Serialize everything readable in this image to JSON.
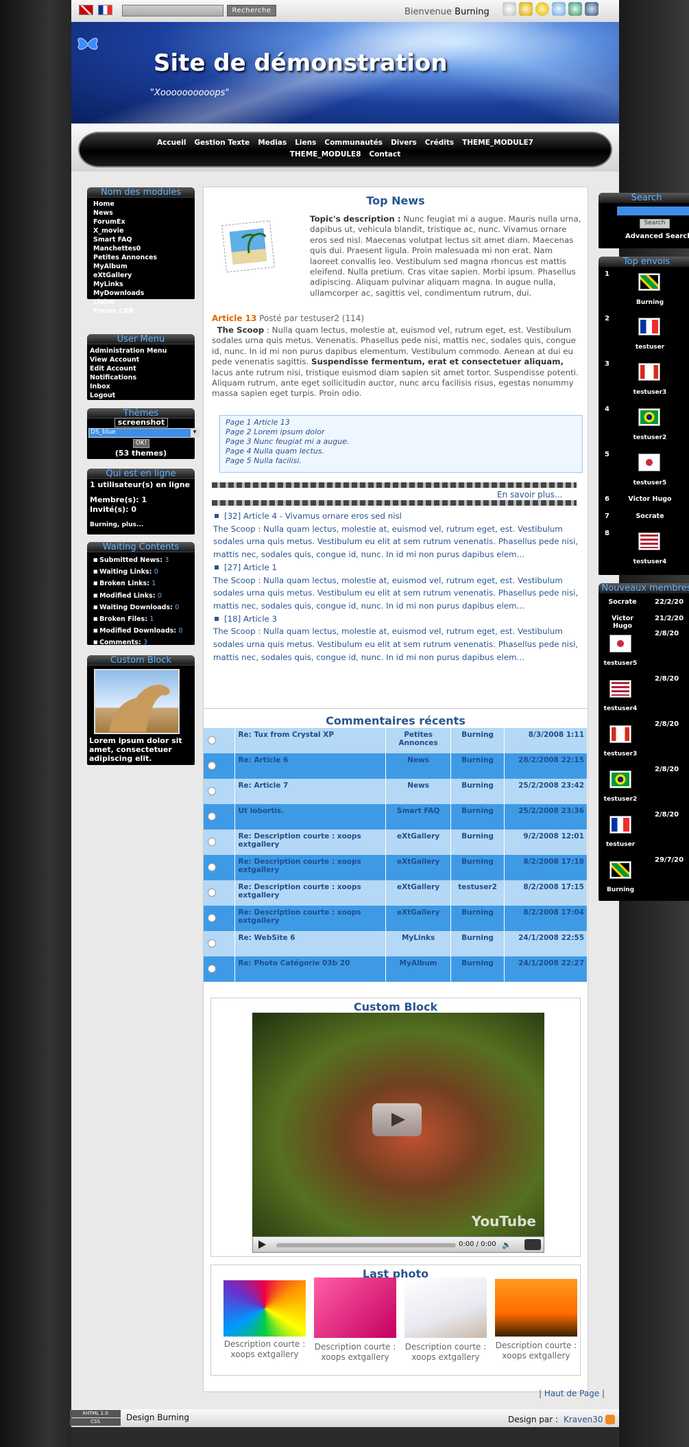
{
  "topbar": {
    "search_button": "Recherche",
    "welcome_prefix": "Bienvenue",
    "welcome_user": "Burning"
  },
  "header": {
    "title": "Site de démonstration",
    "slogan": "\"Xoooooooooops\""
  },
  "nav": {
    "row1": [
      "Accueil",
      "Gestion Texte",
      "Medias",
      "Liens",
      "Communautés",
      "Divers",
      "Crédits",
      "THEME_MODULE7"
    ],
    "row2": [
      "THEME_MODULE8",
      "Contact"
    ]
  },
  "modules": {
    "title": "Nom des modules",
    "items": [
      "Home",
      "News",
      "ForumEx",
      "X_movie",
      "Smart FAQ",
      "Manchettes0",
      "Petites Annonces",
      "MyAlbum",
      "eXtGallery",
      "MyLinks",
      "MyDownloads",
      "Liaise",
      "Forum CBB"
    ]
  },
  "usermenu": {
    "title": "User Menu",
    "items": [
      "Administration Menu",
      "View Account",
      "Edit Account",
      "Notifications",
      "Inbox",
      "Logout"
    ]
  },
  "themes": {
    "title": "Thèmes",
    "screenshot": "screenshot",
    "selected": "DS_blue",
    "ok": "OK!",
    "count": "(53 themes)"
  },
  "online": {
    "title": "Qui est en ligne",
    "line1": "1 utilisateur(s) en ligne",
    "line2": "Membre(s): 1",
    "line3": "Invité(s): 0",
    "line4": "Burning, plus..."
  },
  "waiting": {
    "title": "Waiting Contents",
    "items": [
      {
        "label": "Submitted News:",
        "value": "3"
      },
      {
        "label": "Waiting Links:",
        "value": "0"
      },
      {
        "label": "Broken Links:",
        "value": "1"
      },
      {
        "label": "Modified Links:",
        "value": "0"
      },
      {
        "label": "Waiting Downloads:",
        "value": "0"
      },
      {
        "label": "Broken Files:",
        "value": "1"
      },
      {
        "label": "Modified Downloads:",
        "value": "0"
      },
      {
        "label": "Comments:",
        "value": "3"
      }
    ]
  },
  "custom_left": {
    "title": "Custom Block",
    "text": "Lorem ipsum dolor sit amet, consectetuer adipiscing elit."
  },
  "topnews": {
    "title": "Top News",
    "topic_label": "Topic's description :",
    "topic_text": "Nunc feugiat mi a augue. Mauris nulla urna, dapibus ut, vehicula blandit, tristique ac, nunc. Vivamus ornare eros sed nisl. Maecenas volutpat lectus sit amet diam. Maecenas quis dui. Praesent ligula. Proin malesuada mi non erat. Nam laoreet convallis leo. Vestibulum sed magna rhoncus est mattis eleifend. Nulla pretium. Cras vitae sapien. Morbi ipsum. Phasellus adipiscing. Aliquam pulvinar aliquam magna. In augue nulla, ullamcorper ac, sagittis vel, condimentum rutrum, dui.",
    "article_label": "Article 13",
    "posted": "Posté par testuser2 (114)",
    "scoop_label": "The Scoop",
    "scoop_text": ": Nulla quam lectus, molestie at, euismod vel, rutrum eget, est. Vestibulum sodales urna quis metus. Venenatis. Phasellus pede nisi, mattis nec, sodales quis, congue id, nunc. In id mi non purus dapibus elementum. Vestibulum commodo. Aenean at dui eu pede venenatis sagittis.",
    "bold_text": "Suspendisse fermentum, erat et consectetuer aliquam,",
    "scoop_text2": "lacus ante rutrum nisi, tristique euismod diam sapien sit amet tortor. Suspendisse potenti. Aliquam rutrum, ante eget sollicitudin auctor, nunc arcu facilisis risus, egestas nonummy massa sapien eget turpis. Proin odio.",
    "pages": [
      "Page 1 Article 13",
      "Page 2 Lorem ipsum dolor",
      "Page 3 Nunc feugiat mi a augue.",
      "Page 4 Nulla quam lectus.",
      "Page 5 Nulla facilisi."
    ],
    "more": "En savoir plus...",
    "list": [
      {
        "title": "[32] Article 4 - Vivamus ornare eros sed nisl",
        "text": "The Scoop : Nulla quam lectus, molestie at, euismod vel, rutrum eget, est. Vestibulum sodales urna quis metus. Vestibulum eu elit at sem rutrum venenatis. Phasellus pede nisi, mattis nec, sodales quis, congue id, nunc. In id mi non purus dapibus elem..."
      },
      {
        "title": "[27] Article 1",
        "text": "The Scoop : Nulla quam lectus, molestie at, euismod vel, rutrum eget, est. Vestibulum sodales urna quis metus. Vestibulum eu elit at sem rutrum venenatis. Phasellus pede nisi, mattis nec, sodales quis, congue id, nunc. In id mi non purus dapibus elem..."
      },
      {
        "title": "[18] Article 3",
        "text": "The Scoop : Nulla quam lectus, molestie at, euismod vel, rutrum eget, est. Vestibulum sodales urna quis metus. Vestibulum eu elit at sem rutrum venenatis. Phasellus pede nisi, mattis nec, sodales quis, congue id, nunc. In id mi non purus dapibus elem..."
      }
    ]
  },
  "comments": {
    "title": "Commentaires récents",
    "rows": [
      {
        "t": "Re: Tux from Crystal XP",
        "m": "Petites Annonces",
        "u": "Burning",
        "d": "8/3/2008 1:11"
      },
      {
        "t": "Re: Article 6",
        "m": "News",
        "u": "Burning",
        "d": "28/2/2008 22:15"
      },
      {
        "t": "Re: Article 7",
        "m": "News",
        "u": "Burning",
        "d": "25/2/2008 23:42"
      },
      {
        "t": "Ut lobortis.",
        "m": "Smart FAQ",
        "u": "Burning",
        "d": "25/2/2008 23:36"
      },
      {
        "t": "Re: Description courte : xoops extgallery",
        "m": "eXtGallery",
        "u": "Burning",
        "d": "9/2/2008 12:01"
      },
      {
        "t": "Re: Description courte : xoops extgallery",
        "m": "eXtGallery",
        "u": "Burning",
        "d": "8/2/2008 17:18"
      },
      {
        "t": "Re: Description courte : xoops extgallery",
        "m": "eXtGallery",
        "u": "testuser2",
        "d": "8/2/2008 17:15"
      },
      {
        "t": "Re: Description courte : xoops extgallery",
        "m": "eXtGallery",
        "u": "Burning",
        "d": "8/2/2008 17:04"
      },
      {
        "t": "Re: WebSite 6",
        "m": "MyLinks",
        "u": "Burning",
        "d": "24/1/2008 22:55"
      },
      {
        "t": "Re: Photo Catégorie 03b 20",
        "m": "MyAlbum",
        "u": "Burning",
        "d": "24/1/2008 22:27"
      }
    ]
  },
  "video": {
    "title": "Custom Block",
    "time": "0:00 / 0:00",
    "brand": "YouTube"
  },
  "lastphoto": {
    "title": "Last photo",
    "captions": [
      "Description courte : xoops extgallery",
      "Description courte : xoops extgallery",
      "Description courte : xoops extgallery",
      "Description courte : xoops extgallery"
    ]
  },
  "rightsearch": {
    "title": "Search",
    "button": "Search",
    "advanced": "Advanced Search"
  },
  "topenvois": {
    "title": "Top envois",
    "items": [
      {
        "rank": "1",
        "name": "Burning",
        "flag": "jm"
      },
      {
        "rank": "2",
        "name": "testuser",
        "flag": "fr"
      },
      {
        "rank": "3",
        "name": "testuser3",
        "flag": "ca"
      },
      {
        "rank": "4",
        "name": "testuser2",
        "flag": "br"
      },
      {
        "rank": "5",
        "name": "testuser5",
        "flag": "kr"
      },
      {
        "rank": "6",
        "name": "Victor Hugo",
        "flag": ""
      },
      {
        "rank": "7",
        "name": "Socrate",
        "flag": ""
      },
      {
        "rank": "8",
        "name": "testuser4",
        "flag": "us"
      }
    ]
  },
  "newmembers": {
    "title": "Nouveaux membres",
    "items": [
      {
        "name": "Socrate",
        "date": "22/2/20",
        "flag": ""
      },
      {
        "name": "Victor Hugo",
        "date": "21/2/20",
        "flag": ""
      },
      {
        "name": "testuser5",
        "date": "2/8/20",
        "flag": "kr"
      },
      {
        "name": "testuser4",
        "date": "2/8/20",
        "flag": "us"
      },
      {
        "name": "testuser3",
        "date": "2/8/20",
        "flag": "ca"
      },
      {
        "name": "testuser2",
        "date": "2/8/20",
        "flag": "br"
      },
      {
        "name": "testuser",
        "date": "2/8/20",
        "flag": "fr"
      },
      {
        "name": "Burning",
        "date": "29/7/20",
        "flag": "jm"
      }
    ]
  },
  "footer": {
    "haut": "| Haut de Page |",
    "design": "Design Burning",
    "designpar": "Design par :",
    "author": "Kraven30",
    "badge1": "XHTML 1.0",
    "badge2": "CSS"
  }
}
